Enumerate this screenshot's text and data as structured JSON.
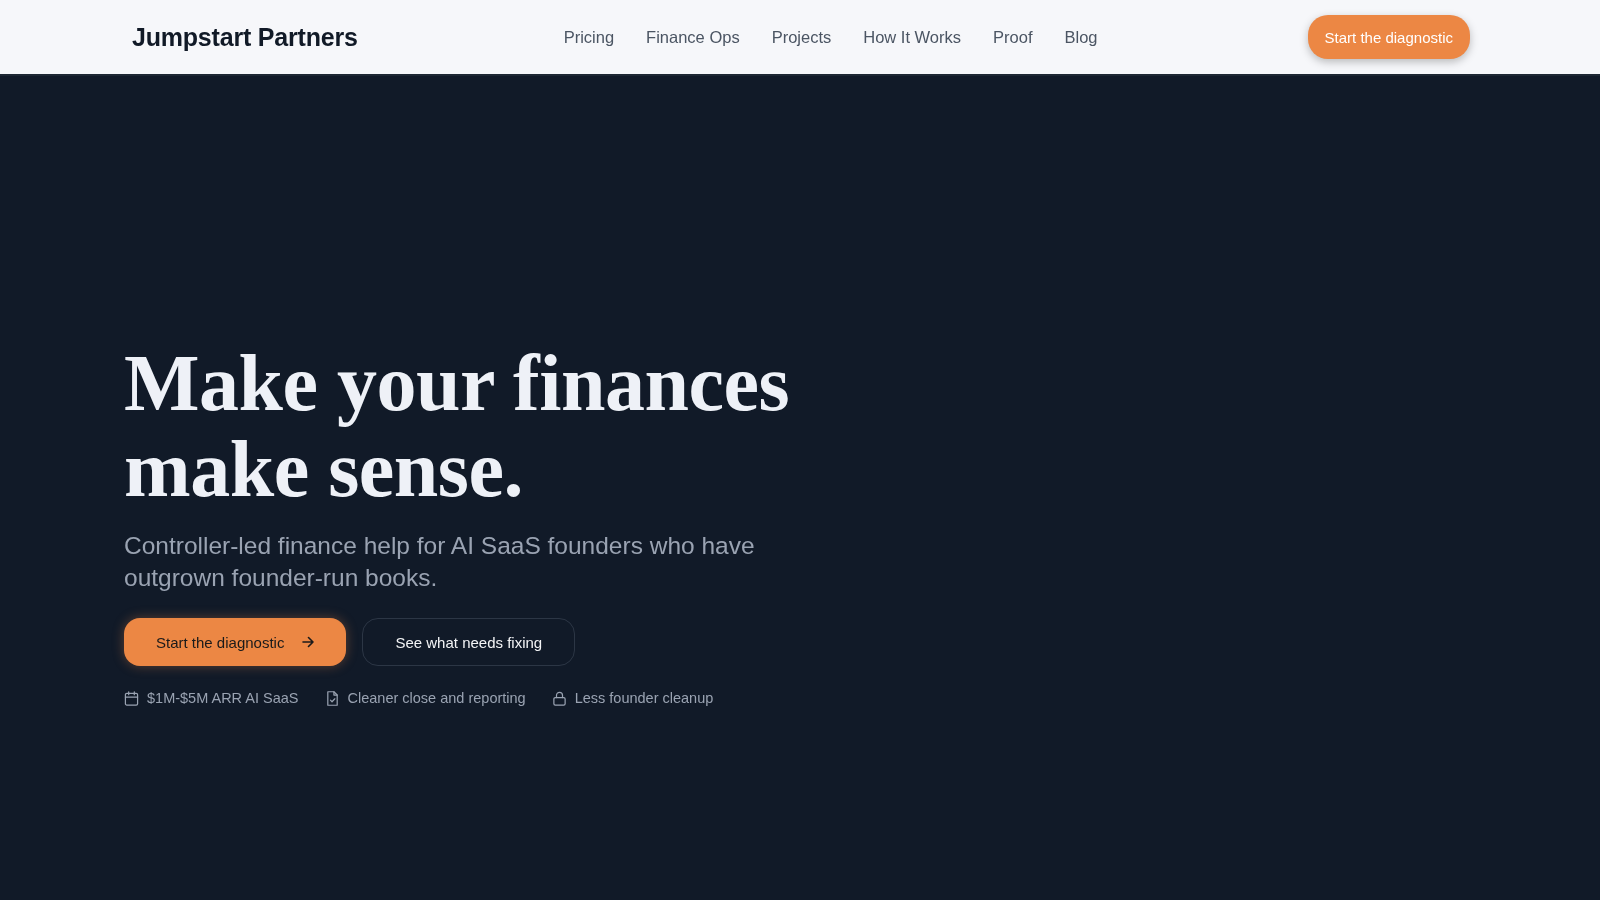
{
  "header": {
    "logo": "Jumpstart Partners",
    "nav": [
      {
        "label": "Pricing"
      },
      {
        "label": "Finance Ops"
      },
      {
        "label": "Projects"
      },
      {
        "label": "How It Works"
      },
      {
        "label": "Proof"
      },
      {
        "label": "Blog"
      }
    ],
    "cta": "Start the diagnostic"
  },
  "hero": {
    "title": "Make your finances make sense.",
    "subtitle": "Controller-led finance help for AI SaaS founders who have outgrown founder-run books.",
    "buttons": [
      {
        "label": "Start the diagnostic",
        "kind": "primary"
      },
      {
        "label": "See what needs fixing",
        "kind": "secondary"
      }
    ],
    "highlights": [
      {
        "kind": "calendar",
        "text": "$1M-$5M ARR AI SaaS"
      },
      {
        "kind": "document",
        "text": "Cleaner close and reporting"
      },
      {
        "kind": "lock",
        "text": "Less founder cleanup"
      }
    ]
  }
}
